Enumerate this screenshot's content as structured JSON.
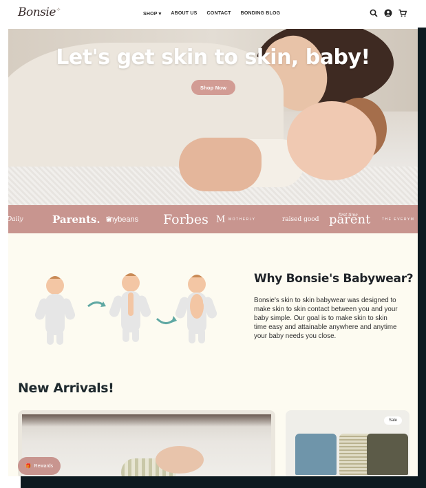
{
  "header": {
    "logo_text": "Bonsie",
    "nav": [
      "SHOP",
      "ABOUT US",
      "CONTACT",
      "BONDING BLOG"
    ],
    "icons": [
      "search-icon",
      "account-icon",
      "cart-icon"
    ]
  },
  "hero": {
    "headline": "Let's get skin to skin, baby!",
    "button_label": "Shop Now"
  },
  "press": {
    "logos": [
      "Daily",
      "Parents.",
      "tinybeans",
      "Forbes",
      "M",
      "MOTHERLY",
      "raised good",
      "first time",
      "parent",
      "THE EVERYM"
    ]
  },
  "why": {
    "title": "Why Bonsie's Babywear?",
    "body": "Bonsie's skin to skin babywear was designed to make skin to skin contact between you and your baby simple. Our goal is to make skin to skin time easy and attainable anywhere and anytime your baby needs you close."
  },
  "arrivals": {
    "title": "New Arrivals!",
    "badge": "Sale"
  },
  "rewards": {
    "label": "Rewards"
  },
  "colors": {
    "accent_pink": "#c8958f",
    "background_cream": "#fdfbf1",
    "heading_dark": "#1f2328"
  }
}
